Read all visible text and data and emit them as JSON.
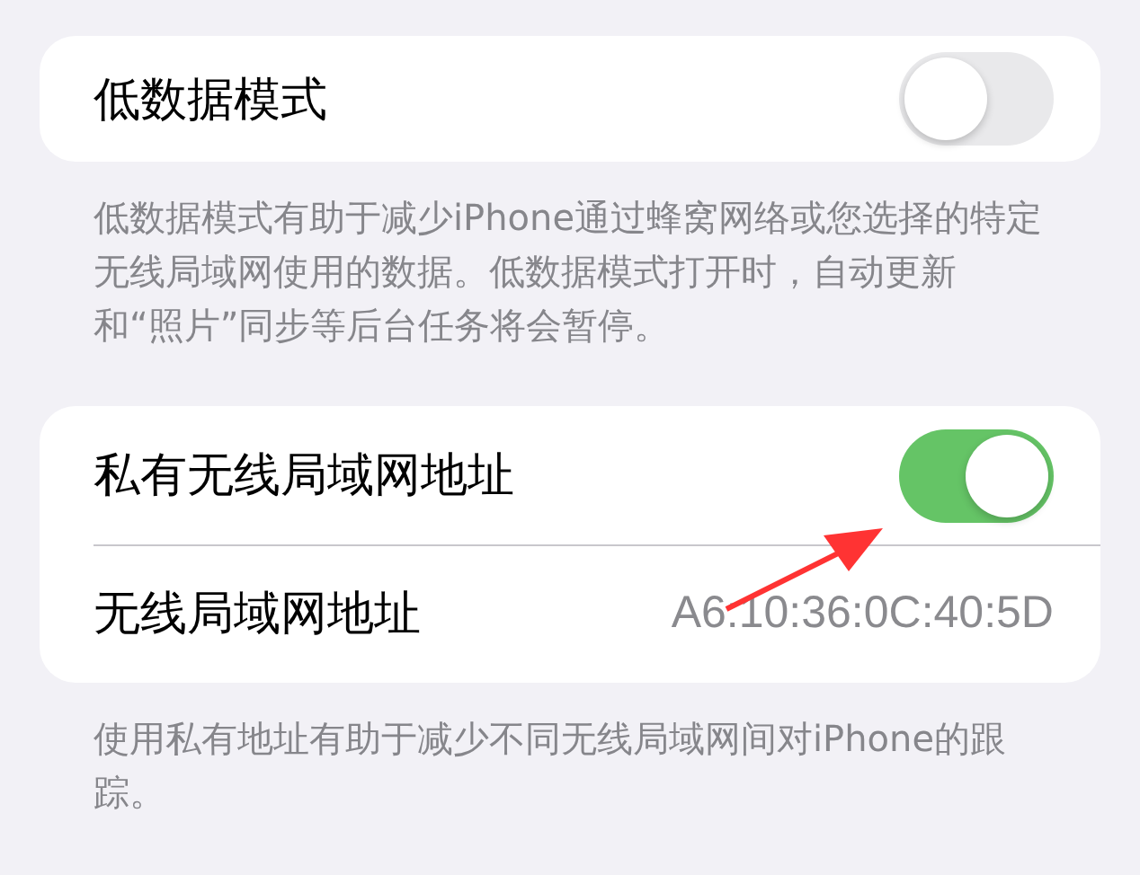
{
  "sections": [
    {
      "rows": [
        {
          "kind": "toggle",
          "label": "低数据模式",
          "on": false
        }
      ],
      "footer": "低数据模式有助于减少iPhone通过蜂窝网络或您选择的特定无线局域网使用的数据。低数据模式打开时，自动更新和“照片”同步等后台任务将会暂停。"
    },
    {
      "rows": [
        {
          "kind": "toggle",
          "label": "私有无线局域网地址",
          "on": true
        },
        {
          "kind": "value",
          "label": "无线局域网地址",
          "value": "A6:10:36:0C:40:5D"
        }
      ],
      "footer": "使用私有地址有助于减少不同无线局域网间对iPhone的跟踪。"
    }
  ]
}
